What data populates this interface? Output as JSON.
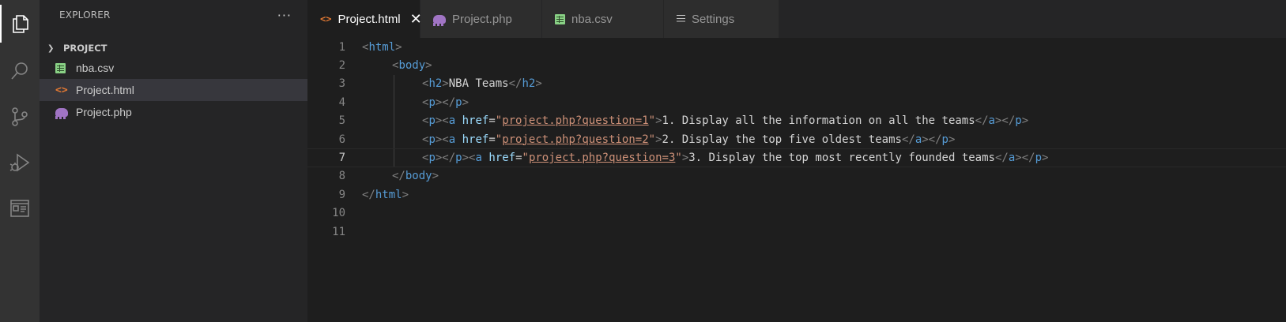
{
  "activity_bar": [
    "explorer-icon",
    "search-icon",
    "source-control-icon",
    "run-debug-icon",
    "extensions-icon"
  ],
  "sidebar": {
    "title": "EXPLORER",
    "more": "···",
    "folder": "PROJECT",
    "files": [
      {
        "name": "nba.csv",
        "icon": "csv-icon"
      },
      {
        "name": "Project.html",
        "icon": "html-icon",
        "selected": true
      },
      {
        "name": "Project.php",
        "icon": "php-icon"
      }
    ]
  },
  "tabs": [
    {
      "label": "Project.html",
      "icon": "html-icon",
      "active": true,
      "close": "✕"
    },
    {
      "label": "Project.php",
      "icon": "php-icon"
    },
    {
      "label": "nba.csv",
      "icon": "csv-icon"
    },
    {
      "label": "Settings",
      "icon": "settings-icon"
    }
  ],
  "editor": {
    "line_numbers": [
      "1",
      "2",
      "3",
      "4",
      "5",
      "6",
      "7",
      "8",
      "9",
      "10",
      "11"
    ],
    "current_line": 7,
    "lines": [
      [
        [
          "<",
          "b"
        ],
        [
          "html",
          "t"
        ],
        [
          ">",
          "b"
        ]
      ],
      [
        [
          "<",
          "b"
        ],
        [
          "body",
          "t"
        ],
        [
          ">",
          "b"
        ]
      ],
      [
        [
          "<",
          "b"
        ],
        [
          "h2",
          "t"
        ],
        [
          ">",
          "b"
        ],
        [
          "NBA Teams",
          "tx"
        ],
        [
          "</",
          "b"
        ],
        [
          "h2",
          "t"
        ],
        [
          ">",
          "b"
        ]
      ],
      [
        [
          "<",
          "b"
        ],
        [
          "p",
          "t"
        ],
        [
          "></",
          "b"
        ],
        [
          "p",
          "t"
        ],
        [
          ">",
          "b"
        ]
      ],
      [
        [
          "<",
          "b"
        ],
        [
          "p",
          "t"
        ],
        [
          "><",
          "b"
        ],
        [
          "a",
          "t"
        ],
        [
          " ",
          "tx"
        ],
        [
          "href",
          "at"
        ],
        [
          "=",
          "tx"
        ],
        [
          "\"",
          "s"
        ],
        [
          "project.php?question=1",
          "s u"
        ],
        [
          "\"",
          "s"
        ],
        [
          ">",
          "b"
        ],
        [
          "1. Display all the information on all the teams",
          "tx"
        ],
        [
          "</",
          "b"
        ],
        [
          "a",
          "t"
        ],
        [
          "></",
          "b"
        ],
        [
          "p",
          "t"
        ],
        [
          ">",
          "b"
        ]
      ],
      [
        [
          "<",
          "b"
        ],
        [
          "p",
          "t"
        ],
        [
          "><",
          "b"
        ],
        [
          "a",
          "t"
        ],
        [
          " ",
          "tx"
        ],
        [
          "href",
          "at"
        ],
        [
          "=",
          "tx"
        ],
        [
          "\"",
          "s"
        ],
        [
          "project.php?question=2",
          "s u"
        ],
        [
          "\"",
          "s"
        ],
        [
          ">",
          "b"
        ],
        [
          "2. Display the top five oldest teams",
          "tx"
        ],
        [
          "</",
          "b"
        ],
        [
          "a",
          "t"
        ],
        [
          "></",
          "b"
        ],
        [
          "p",
          "t"
        ],
        [
          ">",
          "b"
        ]
      ],
      [
        [
          "<",
          "b"
        ],
        [
          "p",
          "t"
        ],
        [
          "></",
          "b"
        ],
        [
          "p",
          "t"
        ],
        [
          "><",
          "b"
        ],
        [
          "a",
          "t"
        ],
        [
          " ",
          "tx"
        ],
        [
          "href",
          "at"
        ],
        [
          "=",
          "tx"
        ],
        [
          "\"",
          "s"
        ],
        [
          "project.php?question=3",
          "s u"
        ],
        [
          "\"",
          "s"
        ],
        [
          ">",
          "b"
        ],
        [
          "3. Display the top most recently founded teams",
          "tx"
        ],
        [
          "</",
          "b"
        ],
        [
          "a",
          "t"
        ],
        [
          "></",
          "b"
        ],
        [
          "p",
          "t"
        ],
        [
          ">",
          "b"
        ]
      ],
      [
        [
          "</",
          "b"
        ],
        [
          "body",
          "t"
        ],
        [
          ">",
          "b"
        ]
      ],
      [
        [
          "</",
          "b"
        ],
        [
          "html",
          "t"
        ],
        [
          ">",
          "b"
        ]
      ],
      [],
      []
    ],
    "indents": [
      0,
      1,
      2,
      2,
      2,
      2,
      2,
      1,
      0,
      0,
      0
    ]
  },
  "colors": {
    "activity_bg": "#333333",
    "sidebar_bg": "#252526",
    "editor_bg": "#1e1e1e",
    "tag": "#569cd6",
    "bracket": "#808080",
    "attr": "#9cdcfe",
    "string": "#ce9178",
    "text": "#d4d4d4"
  }
}
